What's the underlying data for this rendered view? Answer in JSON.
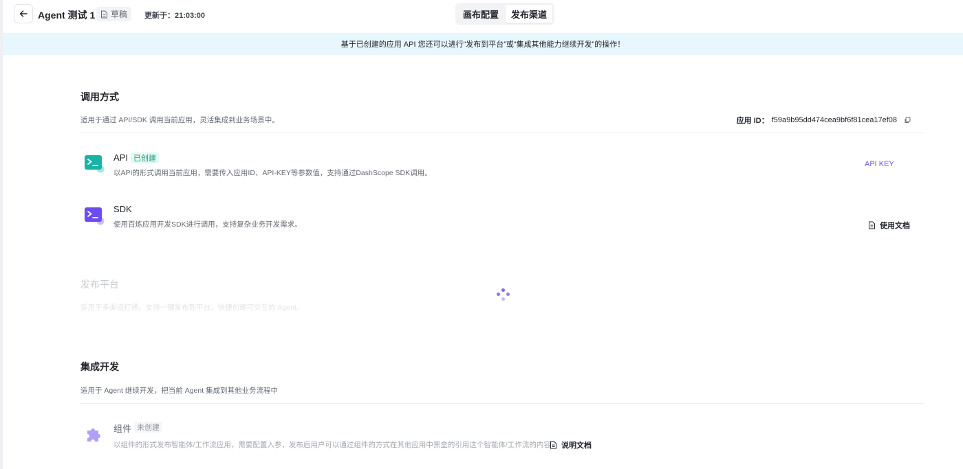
{
  "header": {
    "title": "Agent 测试 1",
    "draft_label": "草稿",
    "updated": "更新于：21:03:00",
    "tabs": [
      {
        "label": "画布配置"
      },
      {
        "label": "发布渠道"
      }
    ]
  },
  "banner": {
    "text": "基于已创建的应用 API 您还可以进行“发布到平台”或“集成其他能力继续开发”的操作！"
  },
  "invoke": {
    "title": "调用方式",
    "desc": "适用于通过 API/SDK 调用当前应用，灵活集成到业务场景中。",
    "app_id_label": "应用 ID：",
    "app_id_value": "f59a9b95dd474cea9bf6f81cea17ef08",
    "api": {
      "name": "API",
      "tag": "已创建",
      "desc": "以API的形式调用当前应用，需要传入应用ID、API-KEY等参数值，支持通过DashScope SDK调用。",
      "action": "API KEY"
    },
    "sdk": {
      "name": "SDK",
      "desc": "使用百炼应用开发SDK进行调用，支持复杂业务开发需求。",
      "action": "使用文档"
    }
  },
  "publish": {
    "title": "发布平台",
    "desc": "适用于多渠道打通，支持一键发布到平台，快捷创建可交互的 Agent。"
  },
  "integrate": {
    "title": "集成开发",
    "desc": "适用于 Agent 继续开发，把当前 Agent 集成到其他业务流程中",
    "component": {
      "name": "组件",
      "tag": "未创建",
      "desc": "以组件的形式发布智能体/工作流应用，需要配置入参，发布后用户可以通过组件的方式在其他应用中黑盒的引用这个智能体/工作流的内容",
      "action": "说明文档"
    }
  },
  "colors": {
    "accent": "#6a56e8",
    "api_icon": "#16b3a6",
    "sdk_icon": "#6c4cf0",
    "banner_bg": "#e8f6fd"
  }
}
